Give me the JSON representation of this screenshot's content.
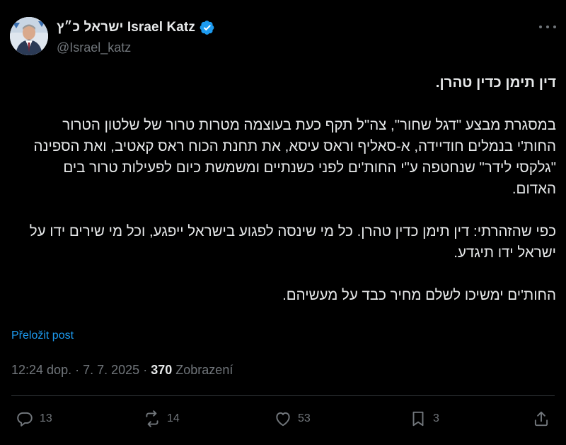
{
  "author": {
    "display_name": "ישראל כ״ץ Israel Katz",
    "handle": "@Israel_katz",
    "verified": true,
    "verified_color": "#1d9bf0"
  },
  "tweet": {
    "title": "דין תימן כדין טהרן.",
    "paragraphs": [
      "במסגרת מבצע \"דגל שחור\", צה\"ל תקף כעת בעוצמה מטרות טרור של שלטון הטרור החות'י בנמלים חודיידה, א-סאליף וראס עיסא, את תחנת הכוח ראס קאטיב, ואת הספינה \"גלקסי לידר\" שנחטפה ע\"י החות'ים לפני כשנתיים ומשמשת כיום לפעילות טרור בים האדום.",
      "כפי שהזהרתי: דין תימן כדין טהרן. כל מי שינסה לפגוע בישראל ייפגע, וכל מי שירים ידו על ישראל ידו תיגדע.",
      "החות'ים ימשיכו לשלם מחיר כבד על מעשיהם."
    ]
  },
  "translate_label": "Přeložit post",
  "meta": {
    "time": "12:24 dop.",
    "separator": "·",
    "date": "7. 7. 2025",
    "views_count": "370",
    "views_label": "Zobrazení"
  },
  "actions": {
    "replies": "13",
    "reposts": "14",
    "likes": "53",
    "bookmarks": "3"
  },
  "colors": {
    "background": "#000000",
    "text": "#e7e9ea",
    "muted": "#71767b",
    "accent": "#1d9bf0"
  }
}
